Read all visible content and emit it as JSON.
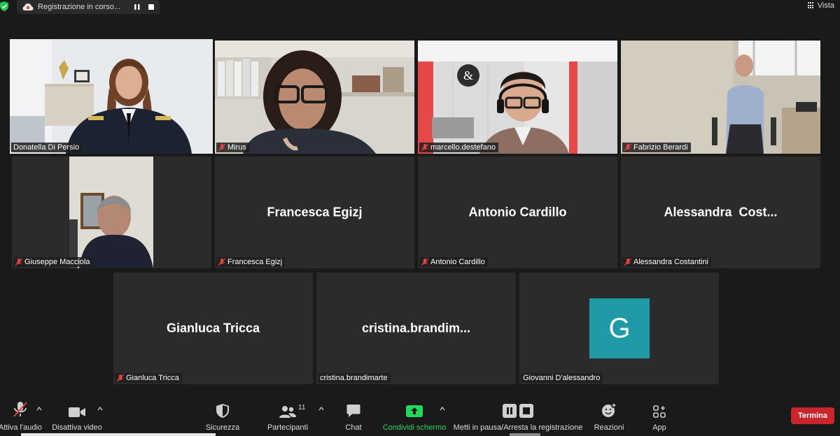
{
  "recording": {
    "status_text": "Registrazione in corso...",
    "pause_icon": "pause-icon",
    "stop_icon": "stop-icon"
  },
  "view": {
    "label": "Vista"
  },
  "participants_tiles": [
    {
      "name": "Donatella Di Persio",
      "video": true,
      "muted": false,
      "active_speaker": true
    },
    {
      "name": "Mirus",
      "video": true,
      "muted": true
    },
    {
      "name": "marcello.destefano",
      "video": true,
      "muted": true
    },
    {
      "name": "Fabrizio Berardi",
      "video": true,
      "muted": true
    },
    {
      "name": "Giuseppe Macciola",
      "video": true,
      "muted": true
    },
    {
      "name": "Francesca Egizj",
      "big_name": "Francesca Egizj",
      "video": false,
      "muted": true
    },
    {
      "name": "Antonio Cardillo",
      "big_name": "Antonio Cardillo",
      "video": false,
      "muted": true
    },
    {
      "name": "Alessandra Costantini",
      "big_name": "Alessandra  Cost...",
      "video": false,
      "muted": true
    },
    {
      "name": "Gianluca Tricca",
      "big_name": "Gianluca Tricca",
      "video": false,
      "muted": true
    },
    {
      "name": "cristina.brandimarte",
      "big_name": "cristina.brandim...",
      "video": false,
      "muted": false
    },
    {
      "name": "Giovanni D'alessandro",
      "avatar_letter": "G",
      "avatar_color": "#1f9aa6",
      "video": false,
      "muted": false
    }
  ],
  "toolbar": {
    "audio_label": "Attiva l'audio",
    "video_label": "Disattiva video",
    "security_label": "Sicurezza",
    "participants_label": "Partecipanti",
    "participants_count": "11",
    "chat_label": "Chat",
    "share_label": "Condividi schermo",
    "record_label": "Metti in pausa/Arresta la registrazione",
    "reactions_label": "Reazioni",
    "apps_label": "App",
    "end_label": "Termina"
  },
  "colors": {
    "active_speaker_border": "#d2e56a",
    "share_green": "#23d959",
    "end_red": "#c8262c",
    "muted_red": "#e0443c"
  }
}
